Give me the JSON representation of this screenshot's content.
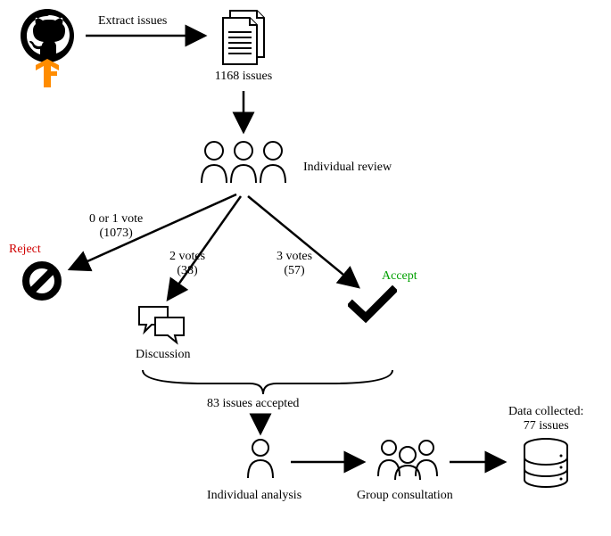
{
  "steps": {
    "extract_label": "Extract issues",
    "issues_count_label": "1168 issues",
    "individual_review_label": "Individual review",
    "reject_label": "Reject",
    "accept_label": "Accept",
    "discussion_label": "Discussion",
    "final_accepted_label": "83 issues accepted",
    "individual_analysis_label": "Individual analysis",
    "group_consultation_label": "Group consultation",
    "data_collected_line1": "Data collected:",
    "data_collected_line2": "77 issues"
  },
  "branches": {
    "left": {
      "line1": "0 or 1 vote",
      "line2": "(1073)"
    },
    "middle": {
      "line1": "2 votes",
      "line2": "(38)"
    },
    "right": {
      "line1": "3 votes",
      "line2": "(57)"
    }
  },
  "chart_data": {
    "type": "diagram",
    "title": "Issue filtering workflow",
    "initial_issues": 1168,
    "review_stage": "Individual review",
    "vote_outcomes": [
      {
        "votes": "0 or 1",
        "count": 1073,
        "result": "Reject"
      },
      {
        "votes": "2",
        "count": 38,
        "result": "Discussion"
      },
      {
        "votes": "3",
        "count": 57,
        "result": "Accept"
      }
    ],
    "accepted_after_discussion": 83,
    "pipeline": [
      "Individual analysis",
      "Group consultation"
    ],
    "final_collected": 77
  }
}
